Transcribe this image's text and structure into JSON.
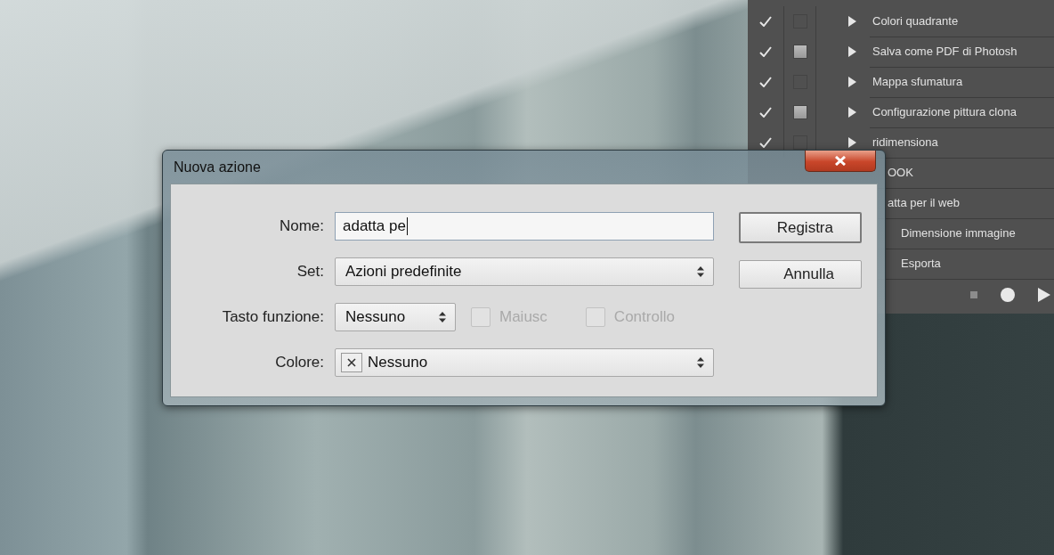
{
  "actions_panel": {
    "rows": [
      {
        "kind": "set",
        "label": "Colori quadrante",
        "checked": true,
        "dialog": false
      },
      {
        "kind": "set",
        "label": "Salva come PDF di Photosh",
        "checked": true,
        "dialog": true
      },
      {
        "kind": "set",
        "label": "Mappa sfumatura",
        "checked": true,
        "dialog": false
      },
      {
        "kind": "set",
        "label": "Configurazione pittura clona",
        "checked": true,
        "dialog": true
      },
      {
        "kind": "set",
        "label": "ridimensiona",
        "checked": true,
        "dialog": false
      },
      {
        "kind": "partial",
        "label": "OOK"
      },
      {
        "kind": "partial",
        "label": "atta per il web",
        "children": [
          {
            "label": "Dimensione immagine"
          },
          {
            "label": "Esporta"
          }
        ]
      }
    ]
  },
  "dialog": {
    "title": "Nuova azione",
    "name": {
      "label": "Nome:",
      "value": "adatta pe"
    },
    "set": {
      "label": "Set:",
      "value": "Azioni predefinite"
    },
    "function_key": {
      "label": "Tasto funzione:",
      "value": "Nessuno"
    },
    "modifiers": [
      {
        "label": "Maiusc",
        "checked": false,
        "disabled": true
      },
      {
        "label": "Controllo",
        "checked": false,
        "disabled": true
      }
    ],
    "color": {
      "label": "Colore:",
      "value": "Nessuno"
    },
    "buttons": [
      {
        "label": "Registra",
        "default": true
      },
      {
        "label": "Annulla",
        "default": false
      }
    ]
  }
}
